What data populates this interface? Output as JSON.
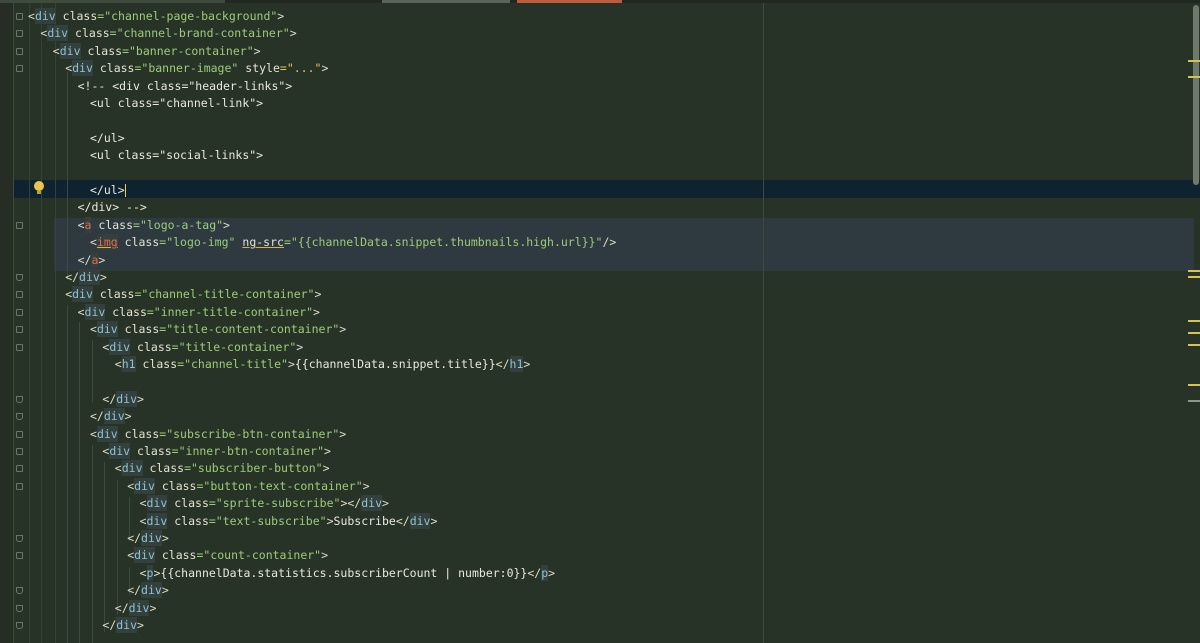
{
  "editor": {
    "tabs": [
      {
        "color": "#3d4a3c"
      },
      {
        "color": "#5a645a"
      },
      {
        "color": "#c05a3c"
      }
    ],
    "lines": [
      {
        "indent": 0,
        "open": "<",
        "name": "div",
        "attrs": [
          {
            "n": "class",
            "v": "\"channel-page-background\""
          }
        ],
        "close": ">"
      },
      {
        "indent": 1,
        "open": "<",
        "name": "div",
        "attrs": [
          {
            "n": "class",
            "v": "\"channel-brand-container\""
          }
        ],
        "close": ">"
      },
      {
        "indent": 2,
        "open": "<",
        "name": "div",
        "attrs": [
          {
            "n": "class",
            "v": "\"banner-container\""
          }
        ],
        "close": ">"
      },
      {
        "indent": 3,
        "open": "<",
        "name": "div",
        "attrs": [
          {
            "n": "class",
            "v": "\"banner-image\""
          },
          {
            "n": "style",
            "v": "=\"...\""
          }
        ],
        "close": ">"
      },
      {
        "indent": 4,
        "text": "<!-- <div class=\"header-links\">"
      },
      {
        "indent": 5,
        "text": "<ul class=\"channel-link\">"
      },
      {
        "indent": 5,
        "text": ""
      },
      {
        "indent": 5,
        "text": "</ul>"
      },
      {
        "indent": 5,
        "text": "<ul class=\"social-links\">"
      },
      {
        "indent": 5,
        "text": ""
      },
      {
        "indent": 5,
        "text": "</ul>",
        "caret": true
      },
      {
        "indent": 4,
        "text": "</div> -->"
      },
      {
        "indent": 4,
        "open": "<",
        "name": "a",
        "red": true,
        "attrs": [
          {
            "n": "class",
            "v": "\"logo-a-tag\""
          }
        ],
        "close": ">"
      },
      {
        "indent": 5,
        "open": "<",
        "name": "img",
        "red": true,
        "squiggle": true,
        "attrs": [
          {
            "n": "class",
            "v": "\"logo-img\""
          },
          {
            "n": "ng-src",
            "v": "\"{{channelData.snippet.thumbnails.high.url}}\"",
            "squiggle": true
          }
        ],
        "close": "/>"
      },
      {
        "indent": 4,
        "open": "</",
        "name": "a",
        "red": true,
        "attrs": [],
        "close": ">"
      },
      {
        "indent": 3,
        "open": "</",
        "name": "div",
        "attrs": [],
        "close": ">"
      },
      {
        "indent": 3,
        "open": "<",
        "name": "div",
        "attrs": [
          {
            "n": "class",
            "v": "\"channel-title-container\""
          }
        ],
        "close": ">"
      },
      {
        "indent": 4,
        "open": "<",
        "name": "div",
        "attrs": [
          {
            "n": "class",
            "v": "\"inner-title-container\""
          }
        ],
        "close": ">"
      },
      {
        "indent": 5,
        "open": "<",
        "name": "div",
        "attrs": [
          {
            "n": "class",
            "v": "\"title-content-container\""
          }
        ],
        "close": ">"
      },
      {
        "indent": 6,
        "open": "<",
        "name": "div",
        "attrs": [
          {
            "n": "class",
            "v": "\"title-container\""
          }
        ],
        "close": ">"
      },
      {
        "indent": 7,
        "open": "<",
        "name": "h1",
        "attrs": [
          {
            "n": "class",
            "v": "\"channel-title\""
          }
        ],
        "close": ">",
        "content": "{{channelData.snippet.title}}",
        "end": "h1"
      },
      {
        "indent": 7,
        "text": ""
      },
      {
        "indent": 6,
        "open": "</",
        "name": "div",
        "attrs": [],
        "close": ">"
      },
      {
        "indent": 5,
        "open": "</",
        "name": "div",
        "attrs": [],
        "close": ">"
      },
      {
        "indent": 5,
        "open": "<",
        "name": "div",
        "attrs": [
          {
            "n": "class",
            "v": "\"subscribe-btn-container\""
          }
        ],
        "close": ">"
      },
      {
        "indent": 6,
        "open": "<",
        "name": "div",
        "attrs": [
          {
            "n": "class",
            "v": "\"inner-btn-container\""
          }
        ],
        "close": ">"
      },
      {
        "indent": 7,
        "open": "<",
        "name": "div",
        "attrs": [
          {
            "n": "class",
            "v": "\"subscriber-button\""
          }
        ],
        "close": ">"
      },
      {
        "indent": 8,
        "open": "<",
        "name": "div",
        "attrs": [
          {
            "n": "class",
            "v": "\"button-text-container\""
          }
        ],
        "close": ">"
      },
      {
        "indent": 9,
        "open": "<",
        "name": "div",
        "attrs": [
          {
            "n": "class",
            "v": "\"sprite-subscribe\""
          }
        ],
        "close": ">",
        "content": "",
        "end": "div"
      },
      {
        "indent": 9,
        "open": "<",
        "name": "div",
        "attrs": [
          {
            "n": "class",
            "v": "\"text-subscribe\""
          }
        ],
        "close": ">",
        "content": "Subscribe",
        "end": "div"
      },
      {
        "indent": 8,
        "open": "</",
        "name": "div",
        "attrs": [],
        "close": ">"
      },
      {
        "indent": 8,
        "open": "<",
        "name": "div",
        "attrs": [
          {
            "n": "class",
            "v": "\"count-container\""
          }
        ],
        "close": ">"
      },
      {
        "indent": 9,
        "open": "<",
        "name": "p",
        "attrs": [],
        "close": ">",
        "content": "{{channelData.statistics.subscriberCount | number:0}}",
        "end": "p"
      },
      {
        "indent": 8,
        "open": "</",
        "name": "div",
        "attrs": [],
        "close": ">"
      },
      {
        "indent": 7,
        "open": "</",
        "name": "div",
        "attrs": [],
        "close": ">"
      },
      {
        "indent": 6,
        "open": "</",
        "name": "div",
        "attrs": [],
        "close": ">"
      }
    ]
  }
}
